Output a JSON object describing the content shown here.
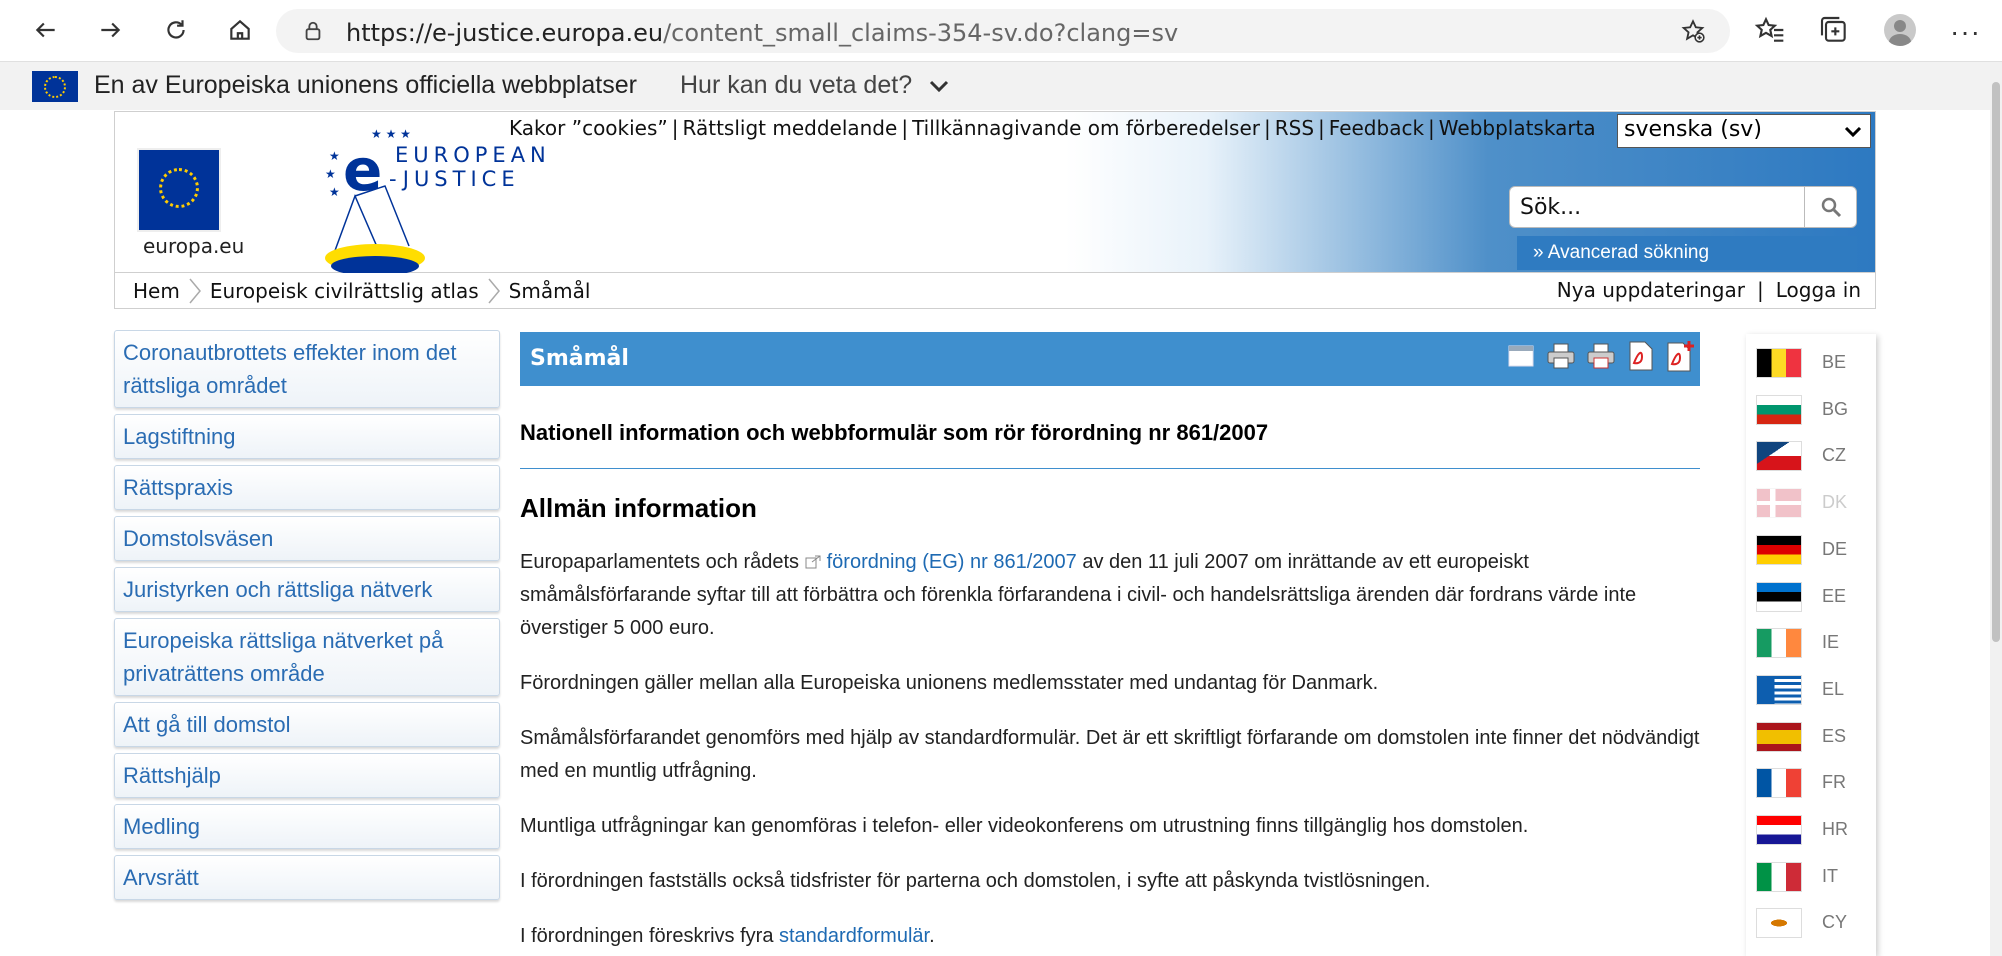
{
  "browser": {
    "url_host": "https://e-justice.europa.eu",
    "url_rest": "/content_small_claims-354-sv.do?clang=sv"
  },
  "official_banner": {
    "text": "En av Europeiska unionens officiella webbplatser",
    "link": "Hur kan du veta det?"
  },
  "header": {
    "europa_label": "europa.eu",
    "logo_line1": "EUROPEAN",
    "logo_line2": "-JUSTICE",
    "top_links": [
      "Kakor ”cookies”",
      "Rättsligt meddelande",
      "Tillkännagivande om förberedelser",
      "RSS",
      "Feedback",
      "Webbplatskarta"
    ],
    "language": "svenska (sv)",
    "search_placeholder": "Sök...",
    "advanced_search": "» Avancerad sökning"
  },
  "breadcrumb": [
    "Hem",
    "Europeisk civilrättslig atlas",
    "Småmål"
  ],
  "user_links": {
    "updates": "Nya uppdateringar",
    "login": "Logga in"
  },
  "sidebar": [
    "Coronautbrottets effekter inom det rättsliga området",
    "Lagstiftning",
    "Rättspraxis",
    "Domstolsväsen",
    "Juristyrken och rättsliga nätverk",
    "Europeiska rättsliga nätverket på privaträttens område",
    "Att gå till domstol",
    "Rättshjälp",
    "Medling",
    "Arvsrätt"
  ],
  "main": {
    "title": "Småmål",
    "subtitle": "Nationell information och webbformulär som rör förordning nr 861/2007",
    "heading": "Allmän information",
    "p1_pre": "Europaparlamentets och rådets ",
    "p1_link": "förordning (EG) nr 861/2007",
    "p1_post": " av den 11 juli 2007 om inrättande av ett europeiskt småmålsförfarande syftar till att förbättra och förenkla förfarandena i civil- och handelsrättsliga ärenden där fordrans värde inte överstiger 5 000 euro.",
    "p2": "Förordningen gäller mellan alla Europeiska unionens medlemsstater med undantag för Danmark.",
    "p3": "Småmålsförfarandet genomförs med hjälp av standardformulär. Det är ett skriftligt förfarande om domstolen inte finner det nödvändigt med en muntlig utfrågning.",
    "p4": "Muntliga utfrågningar kan genomföras i telefon- eller videokonferens om utrustning finns tillgänglig hos domstolen.",
    "p5": "I förordningen fastställs också tidsfrister för parterna och domstolen, i syfte att påskynda tvistlösningen.",
    "p6_pre": "I förordningen föreskrivs fyra ",
    "p6_link": "standardformulär",
    "p6_post": "."
  },
  "flags": [
    {
      "code": "BE",
      "icon": "flag-be-icon"
    },
    {
      "code": "BG",
      "icon": "flag-bg-icon"
    },
    {
      "code": "CZ",
      "icon": "flag-cz-icon"
    },
    {
      "code": "DK",
      "icon": "flag-dk-icon",
      "disabled": true
    },
    {
      "code": "DE",
      "icon": "flag-de-icon"
    },
    {
      "code": "EE",
      "icon": "flag-ee-icon"
    },
    {
      "code": "IE",
      "icon": "flag-ie-icon"
    },
    {
      "code": "EL",
      "icon": "flag-el-icon"
    },
    {
      "code": "ES",
      "icon": "flag-es-icon"
    },
    {
      "code": "FR",
      "icon": "flag-fr-icon"
    },
    {
      "code": "HR",
      "icon": "flag-hr-icon"
    },
    {
      "code": "IT",
      "icon": "flag-it-icon"
    },
    {
      "code": "CY",
      "icon": "flag-cy-icon"
    }
  ],
  "colors": {
    "accent_blue": "#3f8fce",
    "link_blue": "#1e6ab3",
    "eu_blue": "#003399",
    "eu_yellow": "#ffcc00"
  }
}
